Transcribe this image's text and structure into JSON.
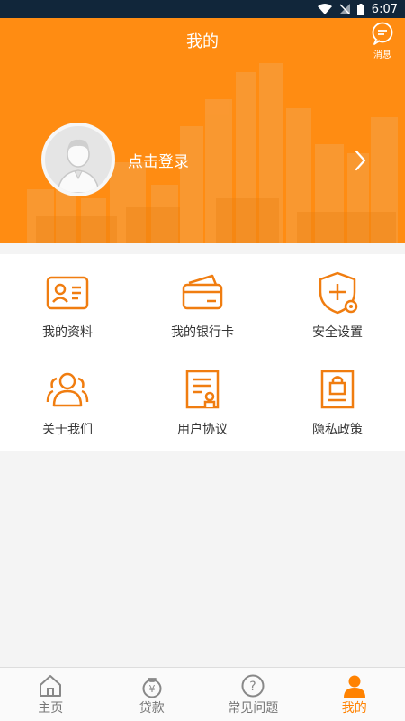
{
  "status_bar": {
    "time": "6:07"
  },
  "header": {
    "title": "我的",
    "message_label": "消息",
    "login_text": "点击登录"
  },
  "menu": {
    "items": [
      {
        "label": "我的资料",
        "icon": "id-card-icon"
      },
      {
        "label": "我的银行卡",
        "icon": "bank-card-icon"
      },
      {
        "label": "安全设置",
        "icon": "shield-icon"
      },
      {
        "label": "关于我们",
        "icon": "people-icon"
      },
      {
        "label": "用户协议",
        "icon": "agreement-icon"
      },
      {
        "label": "隐私政策",
        "icon": "privacy-lock-icon"
      }
    ]
  },
  "tabbar": {
    "tabs": [
      {
        "label": "主页",
        "icon": "home-icon",
        "active": false
      },
      {
        "label": "贷款",
        "icon": "money-bag-icon",
        "active": false
      },
      {
        "label": "常见问题",
        "icon": "question-icon",
        "active": false
      },
      {
        "label": "我的",
        "icon": "person-icon",
        "active": true
      }
    ]
  },
  "colors": {
    "accent": "#ff8c12",
    "icon_orange": "#f07d10",
    "status_bar": "#11263a"
  }
}
